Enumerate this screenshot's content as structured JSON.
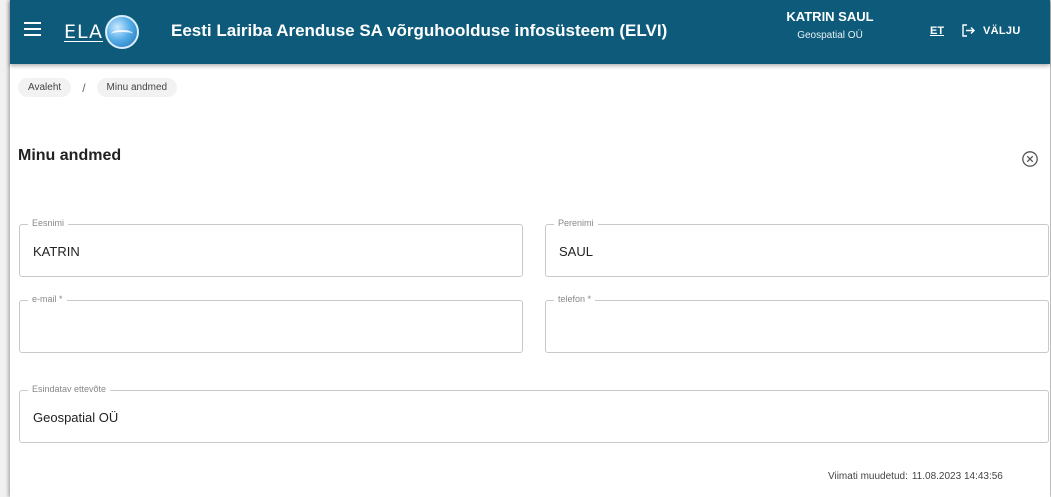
{
  "header": {
    "logo_text": "ELA",
    "title": "Eesti Lairiba Arenduse SA võrguhoolduse infosüsteem (ELVI)",
    "user_name": "KATRIN SAUL",
    "user_org": "Geospatial OÜ",
    "language": "ET",
    "logout_label": "VÄLJU"
  },
  "breadcrumb": {
    "items": [
      "Avaleht",
      "Minu andmed"
    ],
    "separator": "/"
  },
  "page": {
    "title": "Minu andmed"
  },
  "form": {
    "firstname": {
      "label": "Eesnimi",
      "value": "KATRIN"
    },
    "lastname": {
      "label": "Perenimi",
      "value": "SAUL"
    },
    "email": {
      "label": "e-mail *",
      "value": ""
    },
    "phone": {
      "label": "telefon *",
      "value": ""
    },
    "company": {
      "label": "Esindatav ettevõte",
      "value": "Geospatial OÜ"
    }
  },
  "footer": {
    "modified_label": "Viimati muudetud:",
    "modified_value": "11.08.2023 14:43:56"
  },
  "colors": {
    "header_bg": "#0d5a7a",
    "field_border": "#c9c9c9"
  },
  "icons": [
    "menu-icon",
    "globe-logo-icon",
    "logout-icon",
    "close-circle-icon"
  ]
}
